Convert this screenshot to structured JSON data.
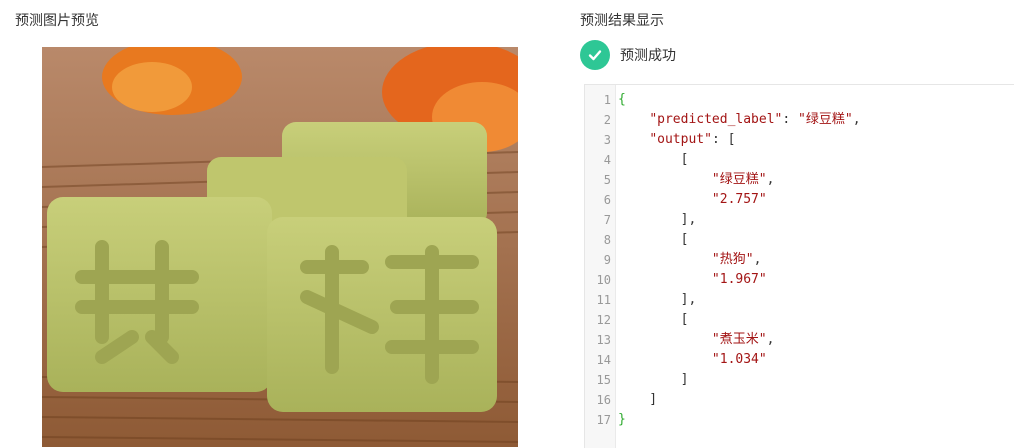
{
  "left_panel": {
    "title": "预测图片预览"
  },
  "right_panel": {
    "title": "预测结果显示",
    "status_text": "预测成功"
  },
  "colors": {
    "success": "#2ec795",
    "brace": "#2eaa2e",
    "string": "#a31515"
  },
  "icons": {
    "status": "check-circle-icon"
  },
  "code_lines": [
    {
      "n": "1",
      "parts": [
        [
          "b",
          "{"
        ]
      ]
    },
    {
      "n": "2",
      "parts": [
        [
          "p",
          "    "
        ],
        [
          "k",
          "\"predicted_label\""
        ],
        [
          "p",
          ": "
        ],
        [
          "s",
          "\"绿豆糕\""
        ],
        [
          "p",
          ","
        ]
      ]
    },
    {
      "n": "3",
      "parts": [
        [
          "p",
          "    "
        ],
        [
          "k",
          "\"output\""
        ],
        [
          "p",
          ": ["
        ]
      ]
    },
    {
      "n": "4",
      "parts": [
        [
          "p",
          "        ["
        ]
      ]
    },
    {
      "n": "5",
      "parts": [
        [
          "p",
          "            "
        ],
        [
          "s",
          "\"绿豆糕\""
        ],
        [
          "p",
          ","
        ]
      ]
    },
    {
      "n": "6",
      "parts": [
        [
          "p",
          "            "
        ],
        [
          "s",
          "\"2.757\""
        ]
      ]
    },
    {
      "n": "7",
      "parts": [
        [
          "p",
          "        ],"
        ]
      ]
    },
    {
      "n": "8",
      "parts": [
        [
          "p",
          "        ["
        ]
      ]
    },
    {
      "n": "9",
      "parts": [
        [
          "p",
          "            "
        ],
        [
          "s",
          "\"热狗\""
        ],
        [
          "p",
          ","
        ]
      ]
    },
    {
      "n": "10",
      "parts": [
        [
          "p",
          "            "
        ],
        [
          "s",
          "\"1.967\""
        ]
      ]
    },
    {
      "n": "11",
      "parts": [
        [
          "p",
          "        ],"
        ]
      ]
    },
    {
      "n": "12",
      "parts": [
        [
          "p",
          "        ["
        ]
      ]
    },
    {
      "n": "13",
      "parts": [
        [
          "p",
          "            "
        ],
        [
          "s",
          "\"煮玉米\""
        ],
        [
          "p",
          ","
        ]
      ]
    },
    {
      "n": "14",
      "parts": [
        [
          "p",
          "            "
        ],
        [
          "s",
          "\"1.034\""
        ]
      ]
    },
    {
      "n": "15",
      "parts": [
        [
          "p",
          "        ]"
        ]
      ]
    },
    {
      "n": "16",
      "parts": [
        [
          "p",
          "    ]"
        ]
      ]
    },
    {
      "n": "17",
      "parts": [
        [
          "b",
          "}"
        ]
      ]
    }
  ]
}
